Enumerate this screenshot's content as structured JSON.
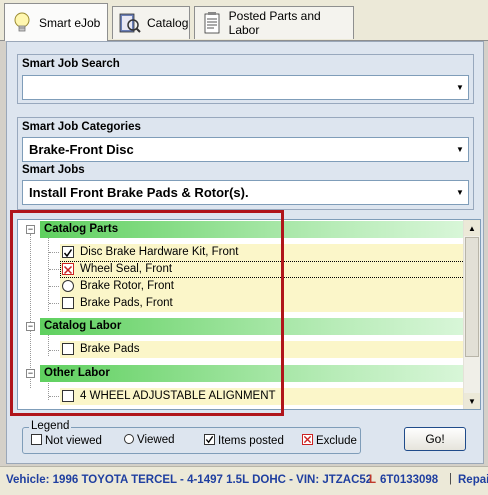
{
  "tabs": [
    {
      "label": "Smart eJob",
      "icon": "lightbulb-icon"
    },
    {
      "label": "Catalog",
      "icon": "catalog-search-icon"
    },
    {
      "label": "Posted Parts and Labor",
      "icon": "notepad-icon"
    }
  ],
  "search": {
    "title": "Smart Job Search",
    "value": ""
  },
  "categories": {
    "title": "Smart Job Categories",
    "value": "Brake-Front Disc"
  },
  "jobs": {
    "title": "Smart Jobs",
    "value": "Install Front Brake Pads & Rotor(s)."
  },
  "tree": {
    "sections": [
      {
        "label": "Catalog Parts",
        "items": [
          {
            "label": "Disc Brake Hardware Kit, Front",
            "state": "checked"
          },
          {
            "label": "Wheel Seal, Front",
            "state": "excluded"
          },
          {
            "label": "Brake Rotor, Front",
            "state": "viewed"
          },
          {
            "label": "Brake Pads, Front",
            "state": "not-viewed"
          }
        ]
      },
      {
        "label": "Catalog Labor",
        "items": [
          {
            "label": "Brake Pads",
            "state": "not-viewed"
          }
        ]
      },
      {
        "label": "Other Labor",
        "items": [
          {
            "label": "4 WHEEL ADJUSTABLE ALIGNMENT",
            "state": "not-viewed"
          }
        ]
      }
    ]
  },
  "legend": {
    "title": "Legend",
    "not_viewed": "Not viewed",
    "viewed": "Viewed",
    "items_posted": "Items posted",
    "exclude": "Exclude"
  },
  "go_label": "Go!",
  "status": {
    "vehicle_prefix": "Vehicle: 1996 TOYOTA TERCEL - 4-1497 1.5L DOHC - VIN: JTZAC52",
    "vin_mid": "L",
    "vin_suffix": "6T0133098",
    "separator": "|",
    "repair": "Repai"
  },
  "colors": {
    "accent_red": "#b0151b",
    "status_blue": "#1f3fa0",
    "section_green": "#5fd05f",
    "item_yellow": "#fbf6c9"
  }
}
